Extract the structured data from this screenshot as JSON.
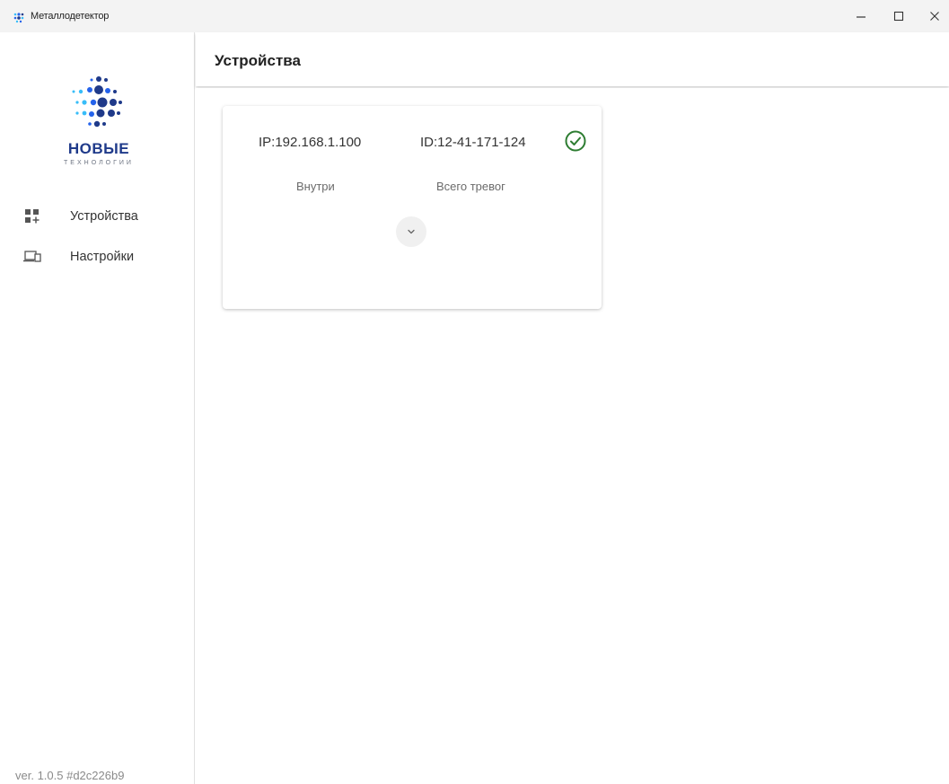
{
  "window": {
    "title": "Металлодетектор",
    "minimize_icon": "minimize-icon",
    "maximize_icon": "maximize-icon",
    "close_icon": "close-icon"
  },
  "sidebar": {
    "logo": {
      "name_main": "НОВЫЕ",
      "name_sub": "ТЕХНОЛОГИИ",
      "colors": {
        "dark": "#1f3a8a",
        "mid": "#2563eb",
        "light": "#38bdf8"
      }
    },
    "items": [
      {
        "label": "Устройства",
        "icon": "device-grid-icon"
      },
      {
        "label": "Настройки",
        "icon": "settings-devices-icon"
      }
    ],
    "version": "ver. 1.0.5 #d2c226b9"
  },
  "header": {
    "title": "Устройства"
  },
  "devices": [
    {
      "ip": "IP:192.168.1.100",
      "id": "ID:12-41-171-124",
      "status_icon": "check-circle-icon",
      "status_color": "#2e7d32",
      "location": "Внутри",
      "alarms_label": "Всего тревог",
      "expand_icon": "chevron-down-icon"
    }
  ]
}
